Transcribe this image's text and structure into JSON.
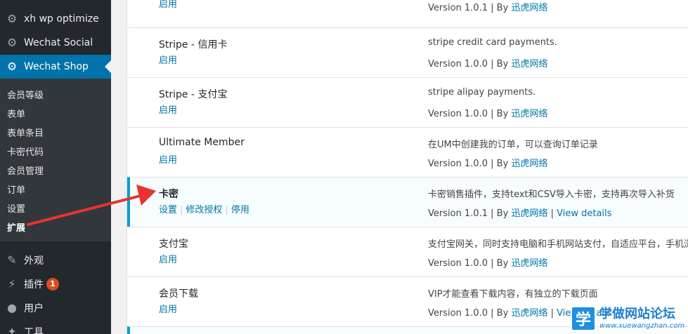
{
  "sidebar": {
    "top_items": [
      {
        "label": "xh wp optimize",
        "icon": "gear-icon"
      },
      {
        "label": "Wechat Social",
        "icon": "gear-icon"
      },
      {
        "label": "Wechat Shop",
        "icon": "gear-icon",
        "current": true
      }
    ],
    "submenu": [
      "会员等级",
      "表单",
      "表单条目",
      "卡密代码",
      "会员管理",
      "订单",
      "设置",
      "扩展"
    ],
    "current_submenu": "扩展",
    "bottom_items": [
      {
        "label": "外观",
        "icon": "paintbrush-icon"
      },
      {
        "label": "插件",
        "icon": "plugin-icon",
        "badge": "1"
      },
      {
        "label": "用户",
        "icon": "user-icon"
      },
      {
        "label": "工具",
        "icon": "wrench-icon"
      }
    ]
  },
  "plugins": [
    {
      "name": "",
      "actions": [
        "启用"
      ],
      "description": "",
      "version": "Version 1.0.1",
      "by": "By",
      "author": "迅虎网络",
      "details": ""
    },
    {
      "name": "Stripe - 信用卡",
      "actions": [
        "启用"
      ],
      "description": "stripe credit card payments.",
      "version": "Version 1.0.0",
      "by": "By",
      "author": "迅虎网络",
      "details": ""
    },
    {
      "name": "Stripe - 支付宝",
      "actions": [
        "启用"
      ],
      "description": "stripe alipay payments.",
      "version": "Version 1.0.0",
      "by": "By",
      "author": "迅虎网络",
      "details": ""
    },
    {
      "name": "Ultimate Member",
      "actions": [
        "启用"
      ],
      "description": "在UM中创建我的订单，可以查询订单记录",
      "version": "Version 1.0.0",
      "by": "By",
      "author": "迅虎网络",
      "details": ""
    },
    {
      "name": "卡密",
      "actions": [
        "设置",
        "修改授权",
        "停用"
      ],
      "description": "卡密销售插件，支持text和CSV导入卡密，支持再次导入补货",
      "version": "Version 1.0.1",
      "by": "By",
      "author": "迅虎网络",
      "details": "View details",
      "active": true
    },
    {
      "name": "支付宝",
      "actions": [
        "启用"
      ],
      "description": "支付宝网关，同时支持电脑和手机网站支付，自适应平台，手机浏",
      "version": "Version 1.0.0",
      "by": "By",
      "author": "迅虎网络",
      "details": ""
    },
    {
      "name": "会员下载",
      "actions": [
        "启用"
      ],
      "description": "VIP才能查看下载内容，有独立的下载页面",
      "version": "Version 1.0.0",
      "by": "By",
      "author": "迅虎网络",
      "details": "View details"
    }
  ],
  "watermark": {
    "logo_char": "学",
    "title": "学做网站论坛",
    "url": "www.xuewangzhan.com"
  },
  "colors": {
    "sidebar_bg": "#23282d",
    "submenu_bg": "#32373c",
    "current_menu": "#0073aa",
    "link": "#0073aa",
    "active_border": "#00a0d2",
    "annotation_arrow": "#e8332f",
    "badge": "#d54e21"
  }
}
